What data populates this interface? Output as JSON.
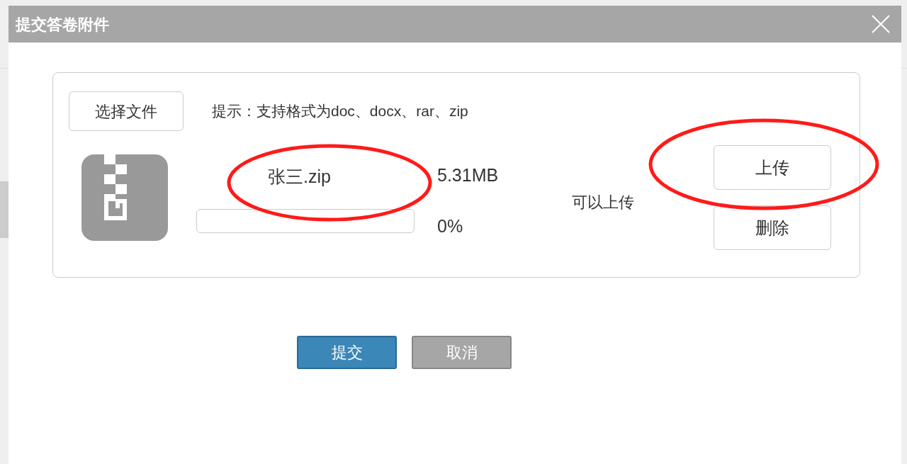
{
  "dialog": {
    "title": "提交答卷附件"
  },
  "choose_button": "选择文件",
  "hint": "提示：支持格式为doc、docx、rar、zip",
  "file": {
    "name": "张三.zip",
    "size": "5.31MB",
    "level": 0,
    "percent": "0%",
    "status": "可以上传"
  },
  "file_actions": [
    "上传",
    "删除"
  ],
  "footer_buttons": [
    {
      "kind": "primary",
      "label": "提交"
    },
    {
      "kind": "secondary",
      "label": "取消"
    }
  ]
}
